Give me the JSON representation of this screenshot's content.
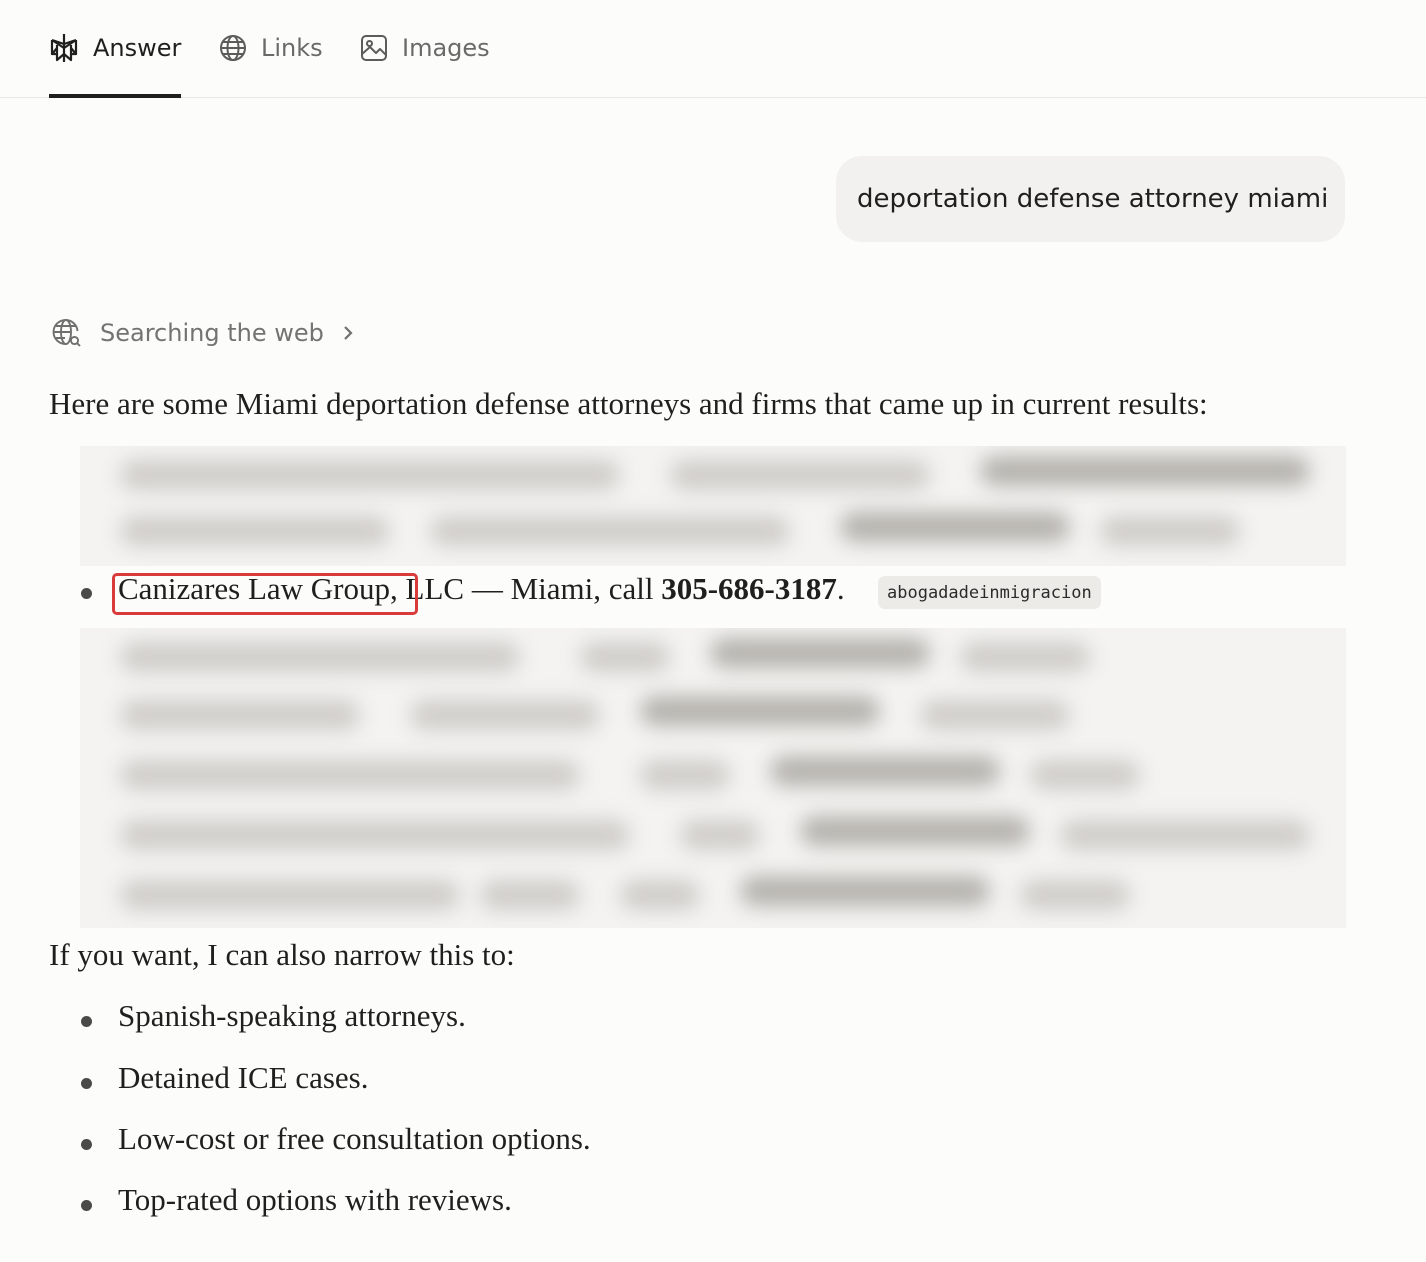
{
  "tabs": [
    {
      "label": "Answer",
      "icon": "perplexity-logo-icon",
      "active": true
    },
    {
      "label": "Links",
      "icon": "globe-icon",
      "active": false
    },
    {
      "label": "Images",
      "icon": "image-icon",
      "active": false
    }
  ],
  "query": "deportation defense attorney miami",
  "searching": {
    "label": "Searching the web",
    "icon": "globe-search-icon"
  },
  "answer": {
    "intro": "Here are some Miami deportation defense attorneys and firms that came up in current results:",
    "result_item": {
      "name_part": "Canizares Law Group,",
      "rest_part": " LLC — Miami, call ",
      "phone": "305-686-3187",
      "period": ".",
      "citation": "abogadadeinmigracion"
    },
    "followup_intro": "If you want, I can also narrow this to:",
    "followup_items": [
      "Spanish-speaking attorneys.",
      "Detained ICE cases.",
      "Low-cost or free consultation options.",
      "Top-rated options with reviews."
    ]
  },
  "colors": {
    "highlight_border": "#d93a3a",
    "background": "#fcfcfb",
    "query_bubble": "#f2f1ef"
  }
}
